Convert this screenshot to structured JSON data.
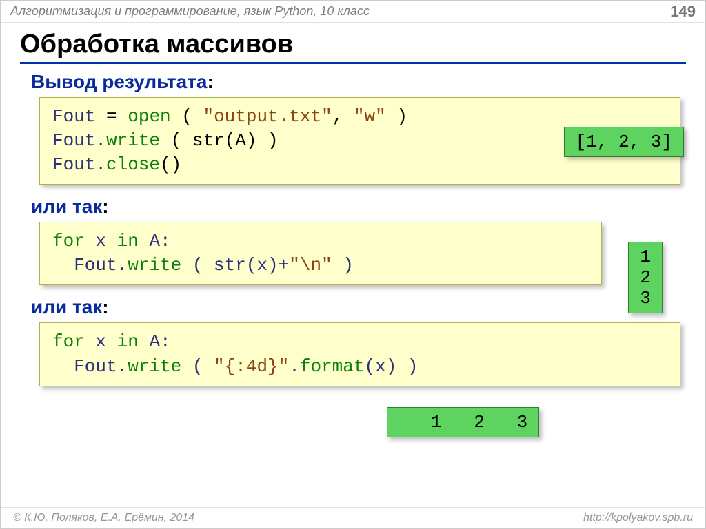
{
  "header": {
    "breadcrumb": "Алгоритмизация и программирование, язык Python, 10 класс",
    "page": "149"
  },
  "title": "Обработка массивов",
  "sections": {
    "s1": {
      "label": "Вывод результата",
      "colon": ":"
    },
    "s2": {
      "label": "или так",
      "colon": ":"
    },
    "s3": {
      "label": "или так",
      "colon": ":"
    }
  },
  "code1": {
    "l1a": "Fout",
    "l1b": " = ",
    "l1c": "open",
    "l1d": " ( ",
    "l1e": "\"output.txt\"",
    "l1f": ", ",
    "l1g": "\"w\"",
    "l1h": " )",
    "l2a": "Fout.",
    "l2b": "write",
    "l2c": " ( str(A) )",
    "l3a": "Fout.",
    "l3b": "close",
    "l3c": "()"
  },
  "out1": "[1, 2, 3]",
  "code2": {
    "l1a": "for",
    "l1b": " x ",
    "l1c": "in",
    "l1d": " A:",
    "l2a": "  Fout.",
    "l2b": "write",
    "l2c": " ( str(x)+",
    "l2d": "\"\\n\"",
    "l2e": " )"
  },
  "out2": "1\n2\n3",
  "code3": {
    "l1a": "for",
    "l1b": " x ",
    "l1c": "in",
    "l1d": " A:",
    "l2a": "  Fout.",
    "l2b": "write",
    "l2c": " ( ",
    "l2d": "\"{:4d}\"",
    "l2e": ".",
    "l2f": "format",
    "l2g": "(x) )"
  },
  "out3": "   1   2   3",
  "footer": {
    "left": "© К.Ю. Поляков, Е.А. Ерёмин, 2014",
    "right": "http://kpolyakov.spb.ru"
  }
}
